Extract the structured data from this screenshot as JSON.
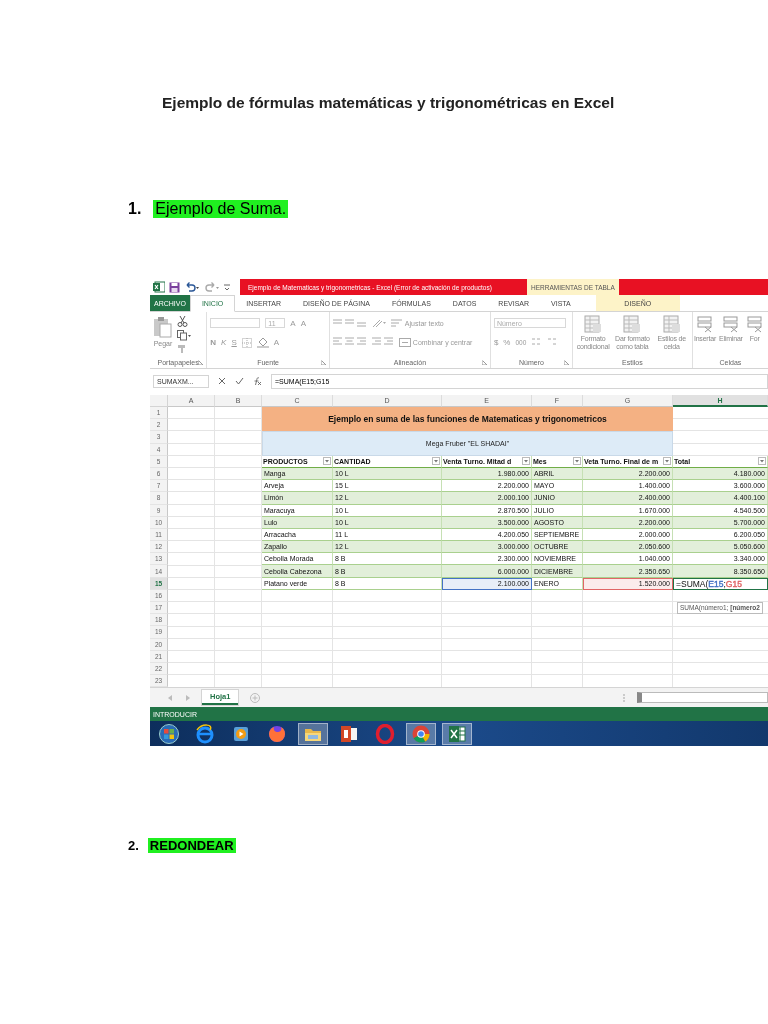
{
  "document": {
    "title": "Ejemplo de fórmulas matemáticas y trigonométricas en Excel",
    "sections": [
      {
        "number": "1.",
        "heading": "Ejemplo de Suma.",
        "bold": false,
        "excel": {
          "title_bar": {
            "title": "Ejemplo de Matematicas y trigonometricas -  Excel (Error de activación de productos)",
            "context_tab": "HERRAMIENTAS DE TABLA"
          },
          "ribbon_tabs": [
            {
              "label": "ARCHIVO",
              "kind": "file",
              "selected": false
            },
            {
              "label": "INICIO",
              "kind": "tab",
              "selected": true
            },
            {
              "label": "INSERTAR",
              "kind": "tab",
              "selected": false
            },
            {
              "label": "DISEÑO DE PÁGINA",
              "kind": "tab",
              "selected": false
            },
            {
              "label": "FÓRMULAS",
              "kind": "tab",
              "selected": false
            },
            {
              "label": "DATOS",
              "kind": "tab",
              "selected": false
            },
            {
              "label": "REVISAR",
              "kind": "tab",
              "selected": false
            },
            {
              "label": "VISTA",
              "kind": "tab",
              "selected": false
            },
            {
              "label": "DISEÑO",
              "kind": "contextual",
              "selected": false
            }
          ],
          "ribbon_groups": [
            {
              "kind": "clipboard",
              "label": "Portapapeles",
              "paste": "Pegar"
            },
            {
              "kind": "font",
              "label": "Fuente",
              "size": "11",
              "grow": "A",
              "shrink": "A",
              "bold": "N",
              "italic": "K",
              "underline": "S",
              "font_color": "A"
            },
            {
              "kind": "alignment",
              "label": "Alineación",
              "wrap": "Ajustar texto",
              "merge": "Combinar y centrar"
            },
            {
              "kind": "number",
              "label": "Número",
              "format": "Número",
              "currency": "$",
              "percent": "%",
              "thousands": "000"
            },
            {
              "kind": "styles",
              "label": "Estilos",
              "buttons": [
                "Formato condicional",
                "Dar formato como tabla",
                "Estilos de celda"
              ]
            },
            {
              "kind": "cells",
              "label": "Celdas",
              "buttons": [
                "Insertar",
                "Eliminar",
                "For"
              ]
            }
          ],
          "name_box": "SUMAXM...",
          "formula": "=SUMA(E15;G15",
          "column_letters": [
            {
              "label": "A",
              "selected": false
            },
            {
              "label": "B",
              "selected": false
            },
            {
              "label": "C",
              "selected": false
            },
            {
              "label": "D",
              "selected": false
            },
            {
              "label": "E",
              "selected": false
            },
            {
              "label": "F",
              "selected": false
            },
            {
              "label": "G",
              "selected": false
            },
            {
              "label": "H",
              "selected": true
            }
          ],
          "row_headers": [
            {
              "label": "1",
              "selected": false
            },
            {
              "label": "2",
              "selected": false
            },
            {
              "label": "3",
              "selected": false
            },
            {
              "label": "4",
              "selected": false
            },
            {
              "label": "5",
              "selected": false
            },
            {
              "label": "6",
              "selected": false
            },
            {
              "label": "7",
              "selected": false
            },
            {
              "label": "8",
              "selected": false
            },
            {
              "label": "9",
              "selected": false
            },
            {
              "label": "10",
              "selected": false
            },
            {
              "label": "11",
              "selected": false
            },
            {
              "label": "12",
              "selected": false
            },
            {
              "label": "13",
              "selected": false
            },
            {
              "label": "14",
              "selected": false
            },
            {
              "label": "15",
              "selected": true
            },
            {
              "label": "16",
              "selected": false
            },
            {
              "label": "17",
              "selected": false
            },
            {
              "label": "18",
              "selected": false
            },
            {
              "label": "19",
              "selected": false
            },
            {
              "label": "20",
              "selected": false
            },
            {
              "label": "21",
              "selected": false
            },
            {
              "label": "22",
              "selected": false
            },
            {
              "label": "23",
              "selected": false
            }
          ],
          "banner": "Ejemplo en suma de las funciones de Matematicas y trigonometricos",
          "subtitle": "Mega Fruber \"EL SHADAI\"",
          "table_headers": [
            "PRODUCTOS",
            "CANTIDAD",
            "Venta Turno. Mitad d",
            "Mes",
            "Veta Turno. Final de m",
            "Total"
          ],
          "rows": [
            {
              "banded": true,
              "cells": [
                {
                  "text": "Manga"
                },
                {
                  "text": "10 L"
                },
                {
                  "text": "1.980.000"
                },
                {
                  "text": "ABRIL"
                },
                {
                  "text": "2.200.000"
                },
                {
                  "text": "4.180.000"
                }
              ]
            },
            {
              "banded": false,
              "cells": [
                {
                  "text": "Arveja"
                },
                {
                  "text": "15 L"
                },
                {
                  "text": "2.200.000"
                },
                {
                  "text": "MAYO"
                },
                {
                  "text": "1.400.000"
                },
                {
                  "text": "3.600.000"
                }
              ]
            },
            {
              "banded": true,
              "cells": [
                {
                  "text": "Limón"
                },
                {
                  "text": "12 L"
                },
                {
                  "text": "2.000.100"
                },
                {
                  "text": "JUNIO"
                },
                {
                  "text": "2.400.000"
                },
                {
                  "text": "4.400.100"
                }
              ]
            },
            {
              "banded": false,
              "cells": [
                {
                  "text": "Maracuya"
                },
                {
                  "text": "10 L"
                },
                {
                  "text": "2.870.500"
                },
                {
                  "text": "JULIO"
                },
                {
                  "text": "1.670.000"
                },
                {
                  "text": "4.540.500"
                }
              ]
            },
            {
              "banded": true,
              "cells": [
                {
                  "text": "Lulo"
                },
                {
                  "text": "10 L"
                },
                {
                  "text": "3.500.000"
                },
                {
                  "text": "AGOSTO"
                },
                {
                  "text": "2.200.000"
                },
                {
                  "text": "5.700.000"
                }
              ]
            },
            {
              "banded": false,
              "cells": [
                {
                  "text": "Arracacha"
                },
                {
                  "text": "11 L"
                },
                {
                  "text": "4.200.050"
                },
                {
                  "text": "SEPTIEMBRE"
                },
                {
                  "text": "2.000.000"
                },
                {
                  "text": "6.200.050"
                }
              ]
            },
            {
              "banded": true,
              "cells": [
                {
                  "text": "Zapallo"
                },
                {
                  "text": "12 L"
                },
                {
                  "text": "3.000.000"
                },
                {
                  "text": "OCTUBRE"
                },
                {
                  "text": "2.050.600"
                },
                {
                  "text": "5.050.600"
                }
              ]
            },
            {
              "banded": false,
              "cells": [
                {
                  "text": "Cebolla Morada"
                },
                {
                  "text": "8 B"
                },
                {
                  "text": "2.300.000"
                },
                {
                  "text": "NOVIEMBRE"
                },
                {
                  "text": "1.040.000"
                },
                {
                  "text": "3.340.000"
                }
              ]
            },
            {
              "banded": true,
              "cells": [
                {
                  "text": "Cebolla Cabezona"
                },
                {
                  "text": "8 B"
                },
                {
                  "text": "6.000.000"
                },
                {
                  "text": "DICIEMBRE"
                },
                {
                  "text": "2.350.650"
                },
                {
                  "text": "8.350.650"
                }
              ]
            },
            {
              "banded": false,
              "cells": [
                {
                  "text": "Platano verde"
                },
                {
                  "text": "8 B"
                },
                {
                  "text": "2.100.000",
                  "color": "#4472c4"
                },
                {
                  "text": "ENERO"
                },
                {
                  "text": "1.520.000",
                  "color": "#e06666"
                },
                {
                  "editing": true,
                  "parts": [
                    {
                      "text": "=SUMA("
                    },
                    {
                      "text": "E15",
                      "color": "#4472c4"
                    },
                    {
                      "text": ";"
                    },
                    {
                      "text": "G15",
                      "color": "#e06666"
                    }
                  ]
                }
              ]
            }
          ],
          "tooltip": "SUMA(número1; **[número2**",
          "sheets": [
            {
              "label": "Hoja1",
              "selected": true
            }
          ],
          "status": "INTRODUCIR",
          "taskbar": [
            {
              "kind": "start",
              "active": false
            },
            {
              "kind": "globe-e",
              "active": false
            },
            {
              "kind": "player",
              "active": false
            },
            {
              "kind": "fox",
              "active": false
            },
            {
              "kind": "folder",
              "active": true
            },
            {
              "kind": "slides",
              "active": false
            },
            {
              "kind": "ring",
              "active": false
            },
            {
              "kind": "chrome",
              "active": true
            },
            {
              "kind": "sheet",
              "active": true
            }
          ]
        }
      },
      {
        "number": "2.",
        "heading": "REDONDEAR",
        "bold": true
      }
    ]
  }
}
